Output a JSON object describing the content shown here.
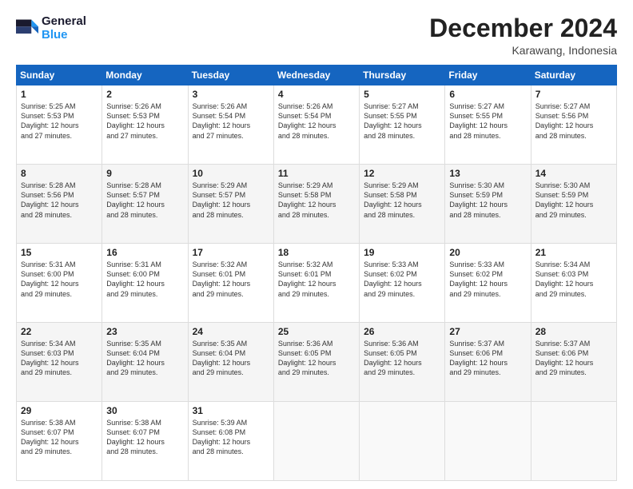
{
  "logo": {
    "line1": "General",
    "line2": "Blue"
  },
  "title": "December 2024",
  "location": "Karawang, Indonesia",
  "days_of_week": [
    "Sunday",
    "Monday",
    "Tuesday",
    "Wednesday",
    "Thursday",
    "Friday",
    "Saturday"
  ],
  "weeks": [
    [
      {
        "day": "1",
        "sunrise": "5:25 AM",
        "sunset": "5:53 PM",
        "daylight": "12 hours and 27 minutes."
      },
      {
        "day": "2",
        "sunrise": "5:26 AM",
        "sunset": "5:53 PM",
        "daylight": "12 hours and 27 minutes."
      },
      {
        "day": "3",
        "sunrise": "5:26 AM",
        "sunset": "5:54 PM",
        "daylight": "12 hours and 27 minutes."
      },
      {
        "day": "4",
        "sunrise": "5:26 AM",
        "sunset": "5:54 PM",
        "daylight": "12 hours and 28 minutes."
      },
      {
        "day": "5",
        "sunrise": "5:27 AM",
        "sunset": "5:55 PM",
        "daylight": "12 hours and 28 minutes."
      },
      {
        "day": "6",
        "sunrise": "5:27 AM",
        "sunset": "5:55 PM",
        "daylight": "12 hours and 28 minutes."
      },
      {
        "day": "7",
        "sunrise": "5:27 AM",
        "sunset": "5:56 PM",
        "daylight": "12 hours and 28 minutes."
      }
    ],
    [
      {
        "day": "8",
        "sunrise": "5:28 AM",
        "sunset": "5:56 PM",
        "daylight": "12 hours and 28 minutes."
      },
      {
        "day": "9",
        "sunrise": "5:28 AM",
        "sunset": "5:57 PM",
        "daylight": "12 hours and 28 minutes."
      },
      {
        "day": "10",
        "sunrise": "5:29 AM",
        "sunset": "5:57 PM",
        "daylight": "12 hours and 28 minutes."
      },
      {
        "day": "11",
        "sunrise": "5:29 AM",
        "sunset": "5:58 PM",
        "daylight": "12 hours and 28 minutes."
      },
      {
        "day": "12",
        "sunrise": "5:29 AM",
        "sunset": "5:58 PM",
        "daylight": "12 hours and 28 minutes."
      },
      {
        "day": "13",
        "sunrise": "5:30 AM",
        "sunset": "5:59 PM",
        "daylight": "12 hours and 28 minutes."
      },
      {
        "day": "14",
        "sunrise": "5:30 AM",
        "sunset": "5:59 PM",
        "daylight": "12 hours and 29 minutes."
      }
    ],
    [
      {
        "day": "15",
        "sunrise": "5:31 AM",
        "sunset": "6:00 PM",
        "daylight": "12 hours and 29 minutes."
      },
      {
        "day": "16",
        "sunrise": "5:31 AM",
        "sunset": "6:00 PM",
        "daylight": "12 hours and 29 minutes."
      },
      {
        "day": "17",
        "sunrise": "5:32 AM",
        "sunset": "6:01 PM",
        "daylight": "12 hours and 29 minutes."
      },
      {
        "day": "18",
        "sunrise": "5:32 AM",
        "sunset": "6:01 PM",
        "daylight": "12 hours and 29 minutes."
      },
      {
        "day": "19",
        "sunrise": "5:33 AM",
        "sunset": "6:02 PM",
        "daylight": "12 hours and 29 minutes."
      },
      {
        "day": "20",
        "sunrise": "5:33 AM",
        "sunset": "6:02 PM",
        "daylight": "12 hours and 29 minutes."
      },
      {
        "day": "21",
        "sunrise": "5:34 AM",
        "sunset": "6:03 PM",
        "daylight": "12 hours and 29 minutes."
      }
    ],
    [
      {
        "day": "22",
        "sunrise": "5:34 AM",
        "sunset": "6:03 PM",
        "daylight": "12 hours and 29 minutes."
      },
      {
        "day": "23",
        "sunrise": "5:35 AM",
        "sunset": "6:04 PM",
        "daylight": "12 hours and 29 minutes."
      },
      {
        "day": "24",
        "sunrise": "5:35 AM",
        "sunset": "6:04 PM",
        "daylight": "12 hours and 29 minutes."
      },
      {
        "day": "25",
        "sunrise": "5:36 AM",
        "sunset": "6:05 PM",
        "daylight": "12 hours and 29 minutes."
      },
      {
        "day": "26",
        "sunrise": "5:36 AM",
        "sunset": "6:05 PM",
        "daylight": "12 hours and 29 minutes."
      },
      {
        "day": "27",
        "sunrise": "5:37 AM",
        "sunset": "6:06 PM",
        "daylight": "12 hours and 29 minutes."
      },
      {
        "day": "28",
        "sunrise": "5:37 AM",
        "sunset": "6:06 PM",
        "daylight": "12 hours and 29 minutes."
      }
    ],
    [
      {
        "day": "29",
        "sunrise": "5:38 AM",
        "sunset": "6:07 PM",
        "daylight": "12 hours and 29 minutes."
      },
      {
        "day": "30",
        "sunrise": "5:38 AM",
        "sunset": "6:07 PM",
        "daylight": "12 hours and 28 minutes."
      },
      {
        "day": "31",
        "sunrise": "5:39 AM",
        "sunset": "6:08 PM",
        "daylight": "12 hours and 28 minutes."
      },
      null,
      null,
      null,
      null
    ]
  ],
  "labels": {
    "sunrise_prefix": "Sunrise: ",
    "sunset_prefix": "Sunset: ",
    "daylight_prefix": "Daylight: "
  }
}
